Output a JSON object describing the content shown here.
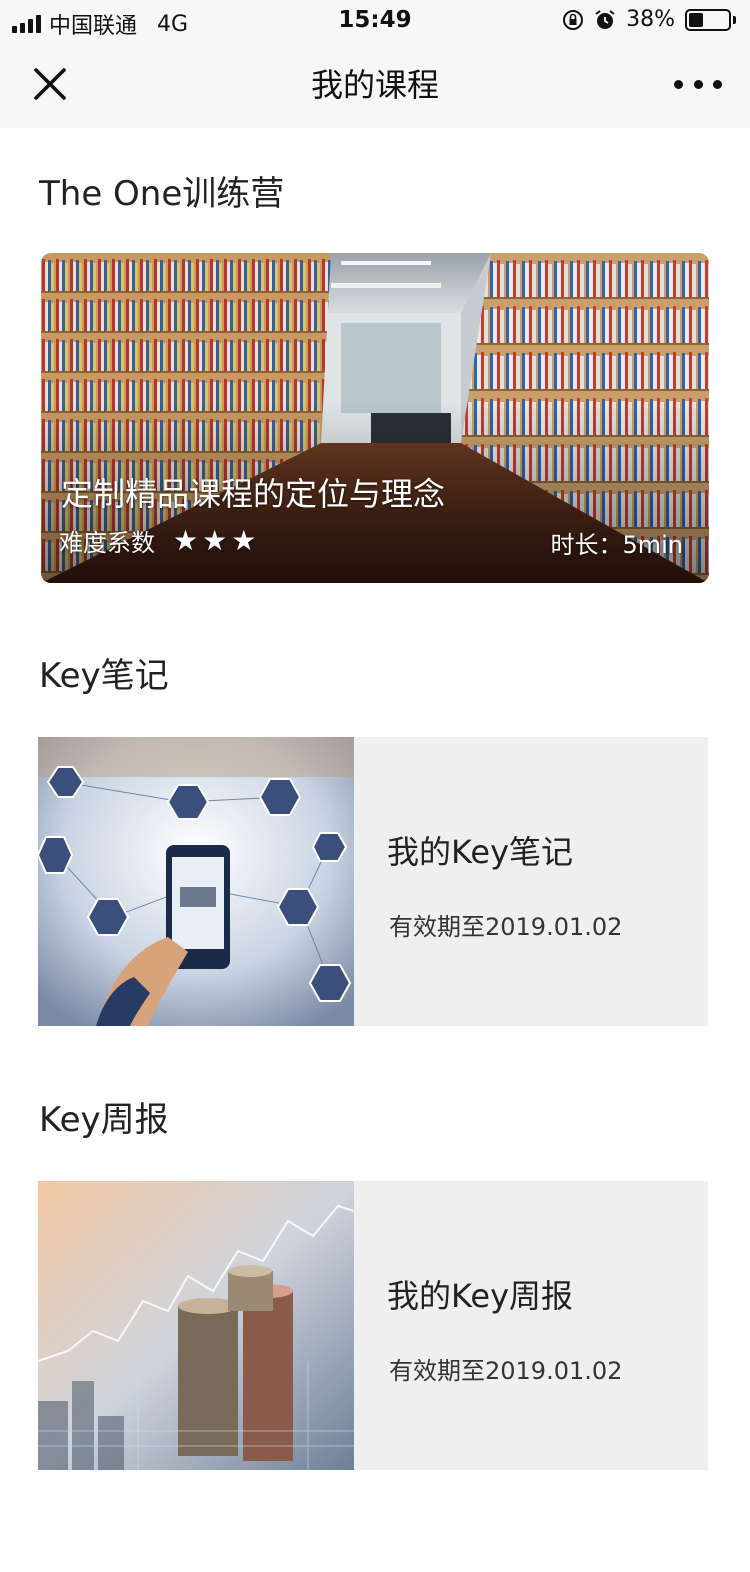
{
  "status_bar": {
    "carrier": "中国联通",
    "network": "4G",
    "time": "15:49",
    "battery": "38%",
    "battery_level": 0.38
  },
  "nav": {
    "title": "我的课程"
  },
  "camp": {
    "section_title": "The One训练营",
    "course_title": "定制精品课程的定位与理念",
    "difficulty_label": "难度系数",
    "difficulty_stars": 3,
    "duration": "时长：5min"
  },
  "notes": {
    "section_title": "Key笔记",
    "card_title": "我的Key笔记",
    "valid_until": "有效期至2019.01.02"
  },
  "weekly": {
    "section_title": "Key周报",
    "card_title": "我的Key周报",
    "valid_until": "有效期至2019.01.02"
  },
  "colors": {
    "nav_bg": "#f7f7f7",
    "card_bg": "#efefef",
    "text": "#222222"
  }
}
